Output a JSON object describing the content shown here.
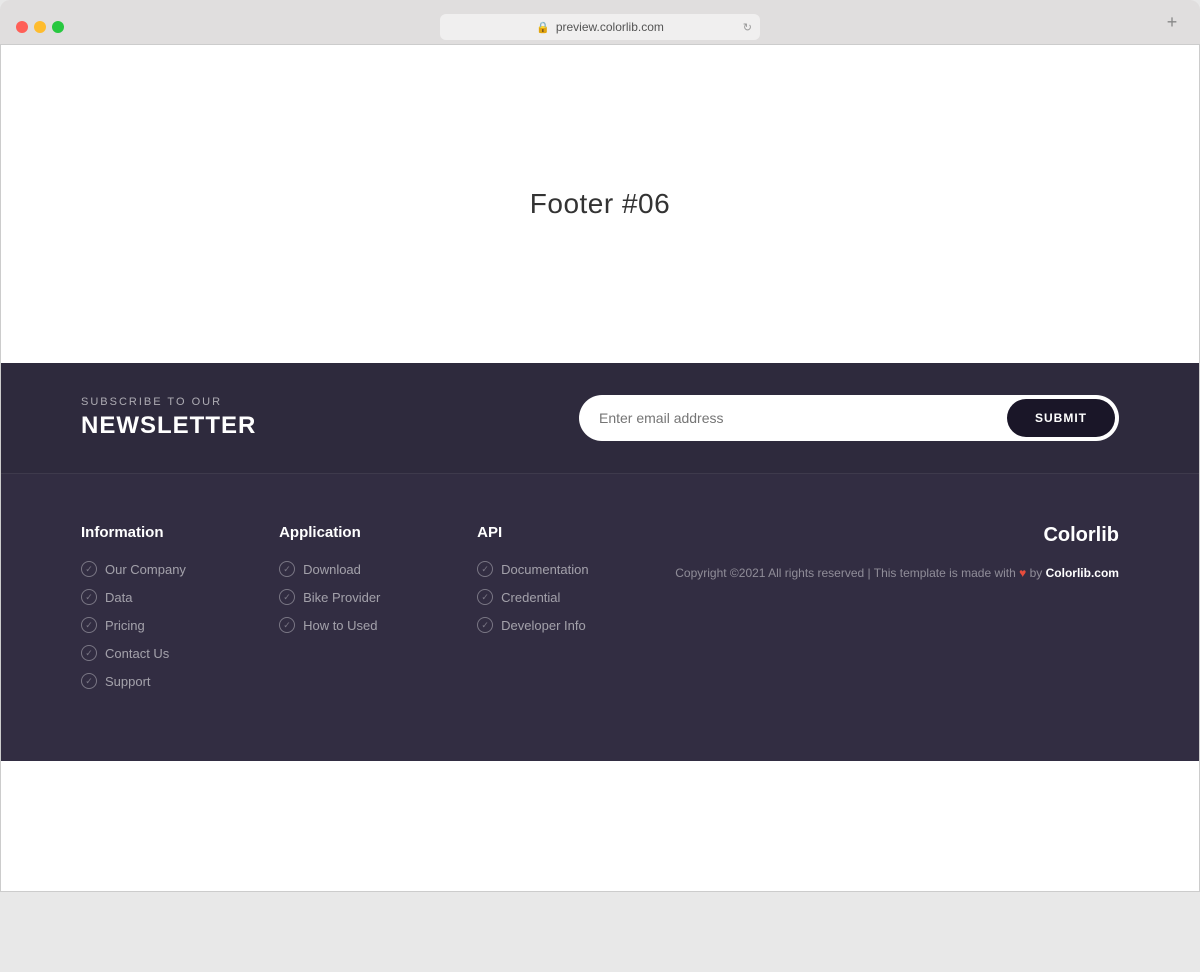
{
  "browser": {
    "url": "preview.colorlib.com",
    "new_tab_label": "+"
  },
  "page": {
    "title": "Footer #06"
  },
  "newsletter": {
    "subtitle": "SUBSCRIBE TO OUR",
    "title": "NEWSLETTER",
    "email_placeholder": "Enter email address",
    "submit_label": "SUBMIT"
  },
  "footer": {
    "columns": [
      {
        "heading": "Information",
        "links": [
          "Our Company",
          "Data",
          "Pricing",
          "Contact Us",
          "Support"
        ]
      },
      {
        "heading": "Application",
        "links": [
          "Download",
          "Bike Provider",
          "How to Used"
        ]
      },
      {
        "heading": "API",
        "links": [
          "Documentation",
          "Credential",
          "Developer Info"
        ]
      }
    ],
    "brand": "Colorlib",
    "copyright": "Copyright ©2021 All rights reserved | This template is made with",
    "copyright_by": "by",
    "copyright_link": "Colorlib.com"
  }
}
